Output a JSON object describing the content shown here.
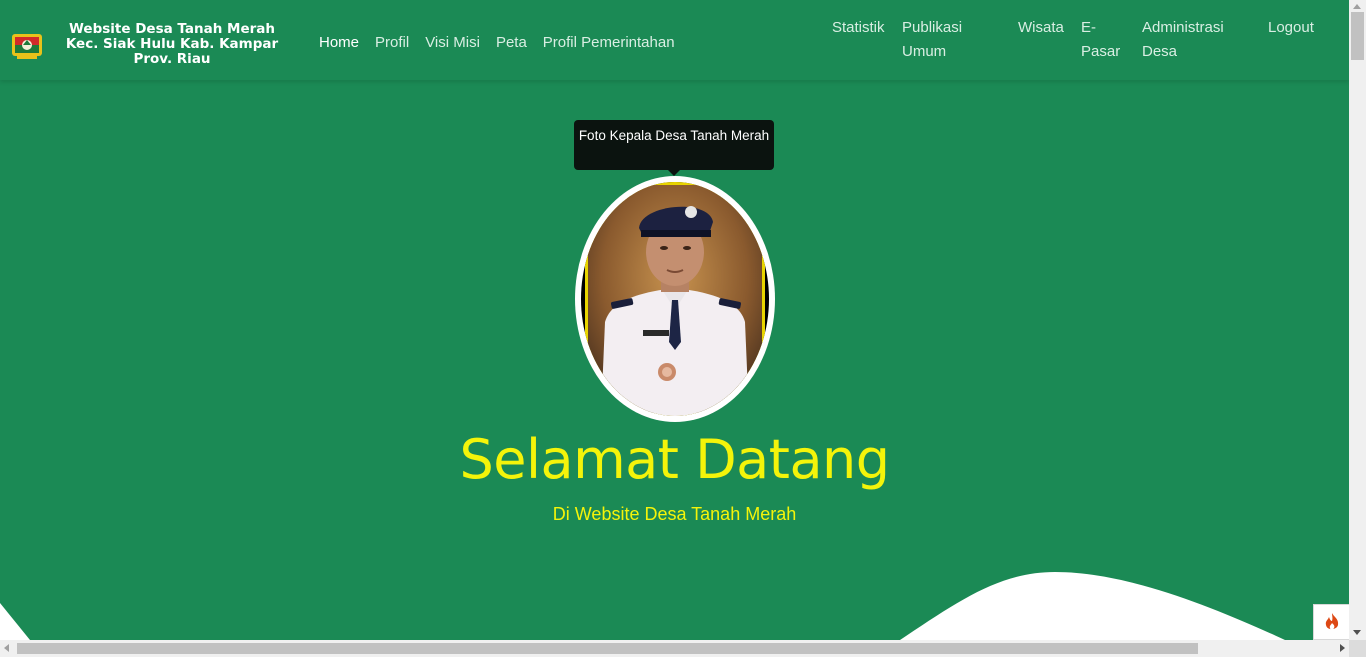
{
  "brand": {
    "title": "Website Desa Tanah Merah Kec. Siak Hulu Kab. Kampar Prov. Riau",
    "logo_icon": "village-emblem-icon"
  },
  "nav_left": [
    {
      "label": "Home",
      "active": true
    },
    {
      "label": "Profil"
    },
    {
      "label": "Visi Misi"
    },
    {
      "label": "Peta"
    },
    {
      "label": "Profil Pemerintahan"
    }
  ],
  "nav_right": [
    {
      "label": "Statistik"
    },
    {
      "label": "Publikasi Umum"
    },
    {
      "label": "Wisata"
    },
    {
      "label": "E-Pasar"
    },
    {
      "label": "Administrasi Desa"
    },
    {
      "label": "Logout"
    }
  ],
  "hero": {
    "tooltip": "Foto Kepala Desa Tanah Merah",
    "title": "Selamat Datang",
    "subtitle": "Di Website Desa Tanah Merah"
  },
  "colors": {
    "background": "#1b8a55",
    "accent_text": "#f4f40a",
    "tooltip_bg": "#0b130f"
  },
  "debug_button": {
    "icon": "fire-icon"
  }
}
